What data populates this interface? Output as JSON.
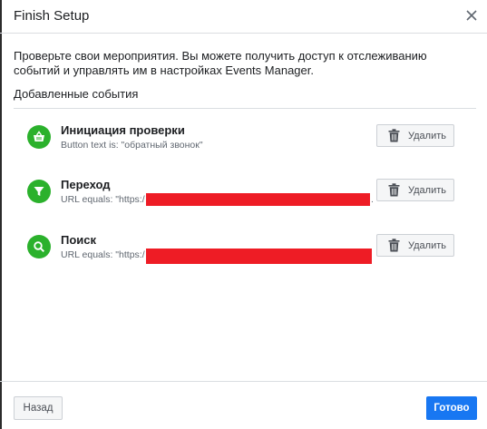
{
  "dialog": {
    "title": "Finish Setup",
    "intro": "Проверьте свои мероприятия. Вы можете получить доступ к отслеживанию событий и управлять им в настройках Events Manager.",
    "section_title": "Добавленные события"
  },
  "events": [
    {
      "icon": "shopping-basket-icon",
      "title": "Инициация проверки",
      "subtitle": "Button text is: \"обратный звонок\"",
      "delete_label": "Удалить"
    },
    {
      "icon": "funnel-icon",
      "title": "Переход",
      "subtitle": "URL equals: \"https:/",
      "subtitle_tail": ".",
      "delete_label": "Удалить"
    },
    {
      "icon": "search-icon",
      "title": "Поиск",
      "subtitle": "URL equals: \"https:/",
      "subtitle_tail": "",
      "delete_label": "Удалить"
    }
  ],
  "footer": {
    "back_label": "Назад",
    "done_label": "Готово"
  },
  "colors": {
    "accent": "#1877f2",
    "event_icon_bg": "#2bb12c",
    "redaction": "#ee1c25"
  }
}
